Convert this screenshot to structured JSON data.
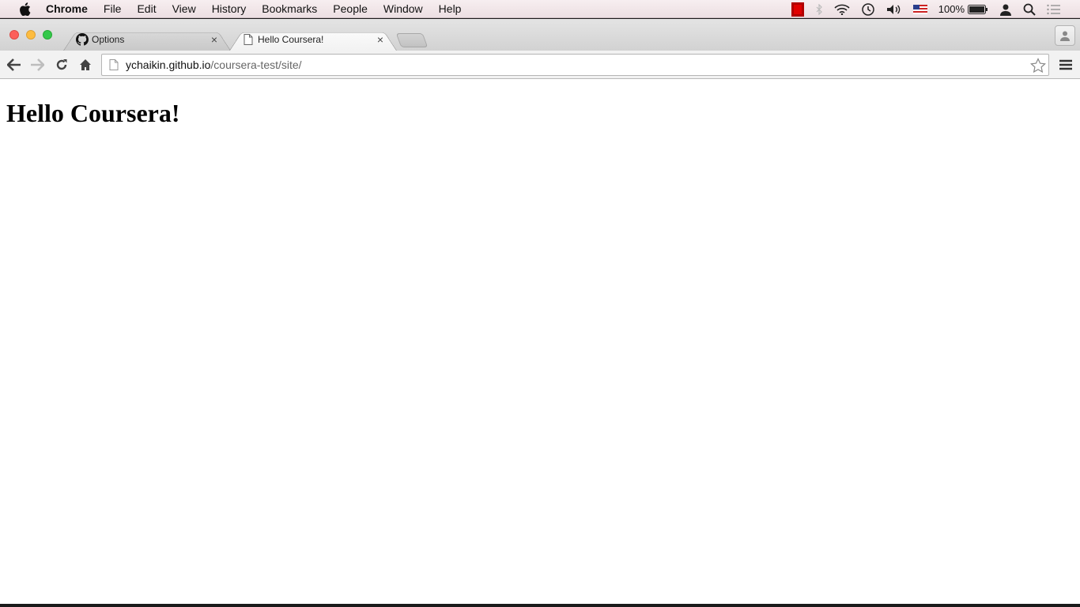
{
  "menubar": {
    "app_name": "Chrome",
    "items": [
      "File",
      "Edit",
      "View",
      "History",
      "Bookmarks",
      "People",
      "Window",
      "Help"
    ],
    "battery_text": "100%"
  },
  "tabs": [
    {
      "title": "Options",
      "icon": "github-icon",
      "active": false
    },
    {
      "title": "Hello Coursera!",
      "icon": "page-icon",
      "active": true
    }
  ],
  "omnibox": {
    "host": "ychaikin.github.io",
    "path": "/coursera-test/site/"
  },
  "page": {
    "heading": "Hello Coursera!"
  },
  "colors": {
    "close": "#fc605b",
    "minimize": "#fdbc40",
    "maximize": "#34c84a"
  }
}
